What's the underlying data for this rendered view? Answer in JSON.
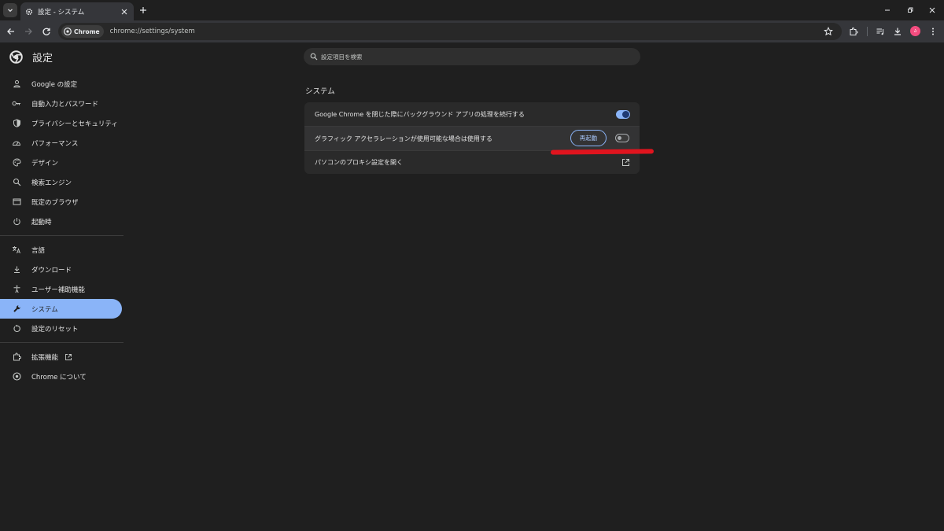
{
  "window": {
    "tab_title": "設定 - システム"
  },
  "toolbar": {
    "chip_label": "Chrome",
    "url": "chrome://settings/system",
    "avatar_initial": "ა"
  },
  "sidebar": {
    "title": "設定",
    "items": [
      {
        "label": "Google の設定",
        "icon": "person-icon"
      },
      {
        "label": "自動入力とパスワード",
        "icon": "key-icon"
      },
      {
        "label": "プライバシーとセキュリティ",
        "icon": "shield-icon"
      },
      {
        "label": "パフォーマンス",
        "icon": "speedometer-icon"
      },
      {
        "label": "デザイン",
        "icon": "palette-icon"
      },
      {
        "label": "検索エンジン",
        "icon": "search-icon"
      },
      {
        "label": "既定のブラウザ",
        "icon": "browser-icon"
      },
      {
        "label": "起動時",
        "icon": "power-icon"
      },
      {
        "label": "言語",
        "icon": "translate-icon"
      },
      {
        "label": "ダウンロード",
        "icon": "download-icon"
      },
      {
        "label": "ユーザー補助機能",
        "icon": "accessibility-icon"
      },
      {
        "label": "システム",
        "icon": "wrench-icon",
        "active": true
      },
      {
        "label": "設定のリセット",
        "icon": "reset-icon"
      },
      {
        "label": "拡張機能",
        "icon": "extension-icon"
      },
      {
        "label": "Chrome について",
        "icon": "chrome-icon"
      }
    ]
  },
  "search": {
    "placeholder": "設定項目を検索"
  },
  "main": {
    "section_title": "システム",
    "rows": [
      {
        "label": "Google Chrome を閉じた際にバックグラウンド アプリの処理を続行する",
        "toggle": true
      },
      {
        "label": "グラフィック アクセラレーションが使用可能な場合は使用する",
        "toggle": false,
        "button": "再起動"
      },
      {
        "label": "パソコンのプロキシ設定を開く"
      }
    ]
  },
  "colors": {
    "accent": "#8ab4f8",
    "background": "#1f1f1f",
    "card": "#2a2a2a",
    "annotation": "#e0141e"
  }
}
